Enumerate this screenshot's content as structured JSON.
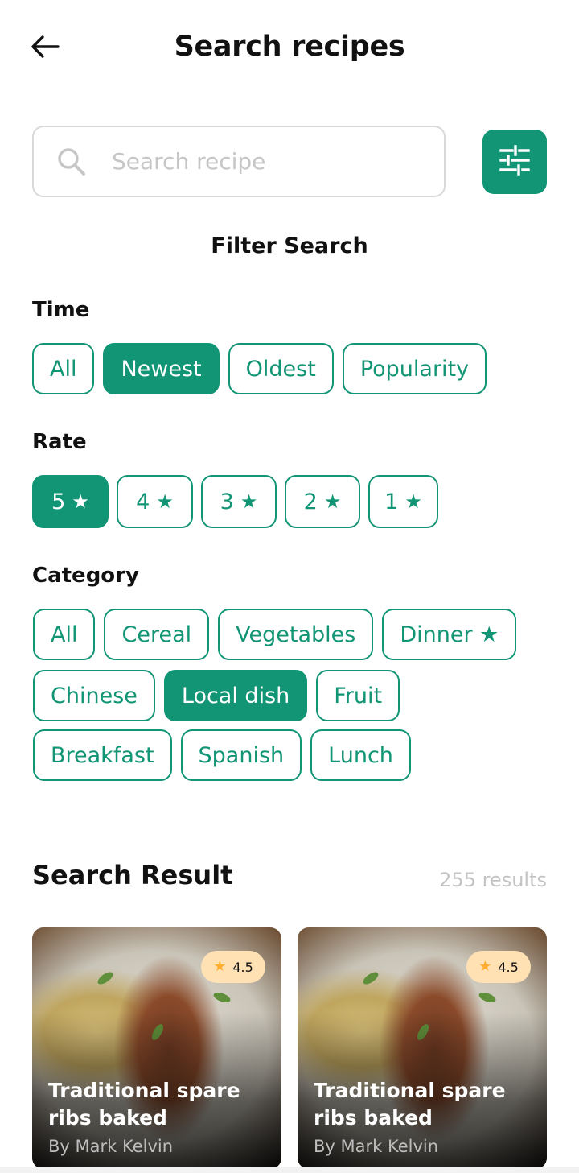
{
  "header": {
    "title": "Search recipes",
    "back_icon": "arrow-left-icon"
  },
  "search": {
    "placeholder": "Search recipe",
    "value": "",
    "icon": "search-icon",
    "filter_icon": "sliders-icon"
  },
  "filter": {
    "heading": "Filter Search",
    "time": {
      "label": "Time",
      "options": [
        "All",
        "Newest",
        "Oldest",
        "Popularity"
      ],
      "selected": "Newest"
    },
    "rate": {
      "label": "Rate",
      "options": [
        "5",
        "4",
        "3",
        "2",
        "1"
      ],
      "star_glyph": "★",
      "selected": "5"
    },
    "category": {
      "label": "Category",
      "options": [
        "All",
        "Cereal",
        "Vegetables",
        "Dinner ★",
        "Chinese",
        "Local dish",
        "Fruit",
        "Breakfast",
        "Spanish",
        "Lunch"
      ],
      "selected": "Local dish"
    }
  },
  "results": {
    "title": "Search Result",
    "count": "255 results",
    "cards": [
      {
        "title": "Traditional spare ribs baked",
        "author": "By Mark Kelvin",
        "rating": "4.5",
        "star_glyph": "★"
      },
      {
        "title": "Traditional spare ribs baked",
        "author": "By Mark Kelvin",
        "rating": "4.5",
        "star_glyph": "★"
      }
    ]
  },
  "colors": {
    "primary": "#129575",
    "rating_badge": "#FFE1B3",
    "rating_star": "#FFAD30",
    "muted_text": "#C4C4C4"
  }
}
